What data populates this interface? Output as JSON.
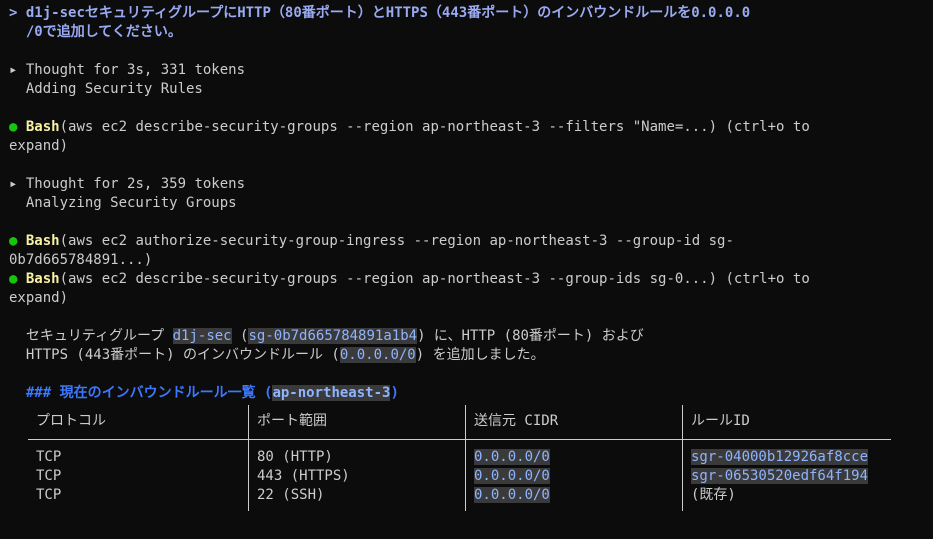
{
  "prompt": {
    "symbol": ">",
    "line1": "d1j-secセキュリティグループにHTTP（80番ポート）とHTTPS（443番ポート）のインバウンドルールを0.0.0.0",
    "line2": "/0で追加してください。"
  },
  "thought1": {
    "marker": "▸",
    "header": "Thought for 3s, 331 tokens",
    "summary": "Adding Security Rules"
  },
  "bash1": {
    "dot": "●",
    "tool": "Bash",
    "line1": "(aws ec2 describe-security-groups --region ap-northeast-3 --filters \"Name=...) (ctrl+o to",
    "line2": "expand)"
  },
  "thought2": {
    "marker": "▸",
    "header": "Thought for 2s, 359 tokens",
    "summary": "Analyzing Security Groups"
  },
  "bash2": {
    "dot": "●",
    "tool": "Bash",
    "line1": "(aws ec2 authorize-security-group-ingress --region ap-northeast-3 --group-id sg-",
    "line2": "0b7d665784891...)"
  },
  "bash3": {
    "dot": "●",
    "tool": "Bash",
    "line1": "(aws ec2 describe-security-groups --region ap-northeast-3 --group-ids sg-0...) (ctrl+o to",
    "line2": "expand)"
  },
  "result": {
    "p1a": "セキュリティグループ ",
    "sg_name": "d1j-sec",
    "p1b": " (",
    "sg_id": "sg-0b7d665784891a1b4",
    "p1c": ") に、HTTP (80番ポート) および",
    "p2a": "HTTPS (443番ポート) のインバウンドルール (",
    "cidr": "0.0.0.0/0",
    "p2b": ") を追加しました。"
  },
  "section": {
    "heading_prefix": "### 現在のインバウンドルール一覧 (",
    "region": "ap-northeast-3",
    "heading_suffix": ")"
  },
  "table": {
    "headers": [
      "プロトコル",
      "ポート範囲",
      "送信元 CIDR",
      "ルールID"
    ],
    "rows": [
      {
        "protocol": "TCP",
        "port": "80 (HTTP)",
        "cidr": "0.0.0.0/0",
        "rule_id": "sgr-04000b12926af8cce"
      },
      {
        "protocol": "TCP",
        "port": "443 (HTTPS)",
        "cidr": "0.0.0.0/0",
        "rule_id": "sgr-06530520edf64f194"
      },
      {
        "protocol": "TCP",
        "port": "22 (SSH)",
        "cidr": "0.0.0.0/0",
        "rule_id": "(既存)"
      }
    ]
  }
}
